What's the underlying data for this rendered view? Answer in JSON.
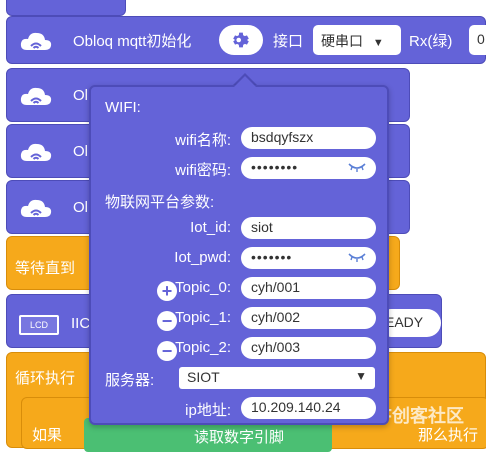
{
  "background_blocks": {
    "top_block_label": "Obloq mqtt初始化",
    "port_label": "接口",
    "port_value": "硬串口",
    "rx_label": "Rx(绿)",
    "rx_value": "0",
    "ob_rows": [
      "Ol",
      "Ol",
      "Ol"
    ],
    "wait_label": "等待直到",
    "lcd_icon_label": "LCD",
    "iic_label": "IIC",
    "ready_label": "EADY",
    "loop_label": "循环执行",
    "if_label": "如果",
    "read_label": "读取数字引脚",
    "then_label": "那么执行",
    "watermark": "DF创客社区"
  },
  "popup": {
    "wifi_header": "WIFI:",
    "wifi_name_label": "wifi名称:",
    "wifi_name_value": "bsdqyfszx",
    "wifi_pw_label": "wifi密码:",
    "wifi_pw_value": "••••••••",
    "iot_header": "物联网平台参数:",
    "iot_id_label": "Iot_id:",
    "iot_id_value": "siot",
    "iot_pwd_label": "Iot_pwd:",
    "iot_pwd_value": "•••••••",
    "topic0_label": "Topic_0:",
    "topic0_value": "cyh/001",
    "topic1_label": "Topic_1:",
    "topic1_value": "cyh/002",
    "topic2_label": "Topic_2:",
    "topic2_value": "cyh/003",
    "server_label": "服务器:",
    "server_value": "SIOT",
    "ip_label": "ip地址:",
    "ip_value": "10.209.140.24"
  },
  "colors": {
    "block_purple": "#6463d8",
    "block_yellow": "#f6a91b",
    "block_green": "#4bbf73"
  }
}
